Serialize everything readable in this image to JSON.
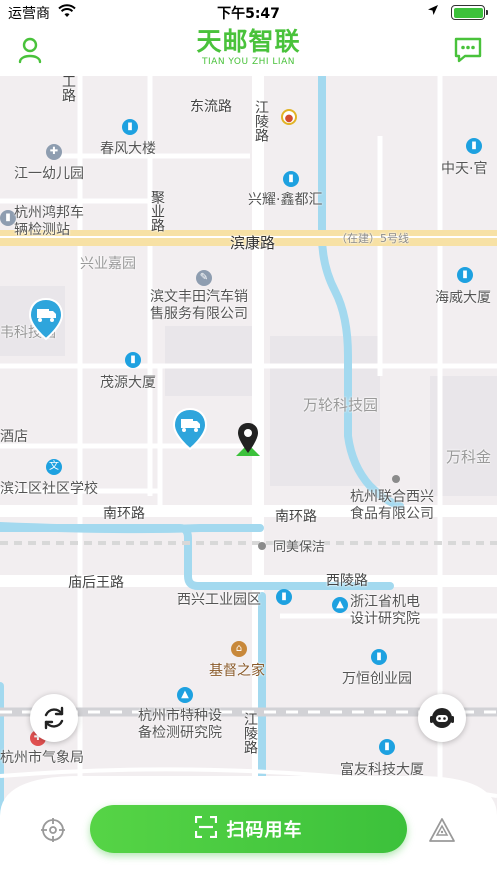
{
  "status_bar": {
    "carrier": "运营商",
    "time": "下午5:47"
  },
  "header": {
    "brand_cn": "天邮智联",
    "brand_en": "TIAN YOU ZHI LIAN",
    "user_icon": "user-icon",
    "chat_icon": "chat-icon"
  },
  "map": {
    "roads": {
      "dongliu": "东流路",
      "jiangling_top": "江陵路",
      "jiangling_bottom": "江陵路",
      "juye": "聚业路",
      "binkang": "滨康路",
      "metro": "（在建）5号线",
      "nanhuan_left": "南环路",
      "nanhuan_right": "南环路",
      "miaohouwang": "庙后王路",
      "xiling": "西陵路",
      "gong_top": "工路"
    },
    "places": {
      "chunfeng": "春风大楼",
      "jiangyi": "江一幼儿园",
      "hongbang": "杭州鸿邦车\n辆检测站",
      "xingye": "兴业嘉园",
      "fengtian": "滨文丰田汽车销\n售服务有限公司",
      "maoyuan": "茂源大厦",
      "wanlun": "万轮科技园",
      "xingyao": "兴耀·鑫都汇",
      "zhongtian": "中天·官",
      "haiwei": "海威大厦",
      "wanke": "万科金",
      "hotel": "酒店",
      "tech_left": "韦科技园",
      "binjiang_school": "滨江区社区学校",
      "lianhe": "杭州联合西兴\n食品有限公司",
      "tongmei": "同美保洁",
      "xixing_park": "西兴工业园区",
      "zhejiang_inst": "浙江省机电\n设计研究院",
      "church": "基督之家",
      "wanheng": "万恒创业园",
      "special_equip": "杭州市特种设\n备检测研究院",
      "weather": "杭州市气象局",
      "fuyou": "富友科技大厦"
    }
  },
  "bottom": {
    "scan_label": "扫码用车",
    "locate_icon": "crosshair-icon",
    "warning_icon": "warning-icon"
  },
  "colors": {
    "brand_green": "#49c23b",
    "river": "#a3d9ef",
    "poi_blue": "#1ea1e0"
  }
}
